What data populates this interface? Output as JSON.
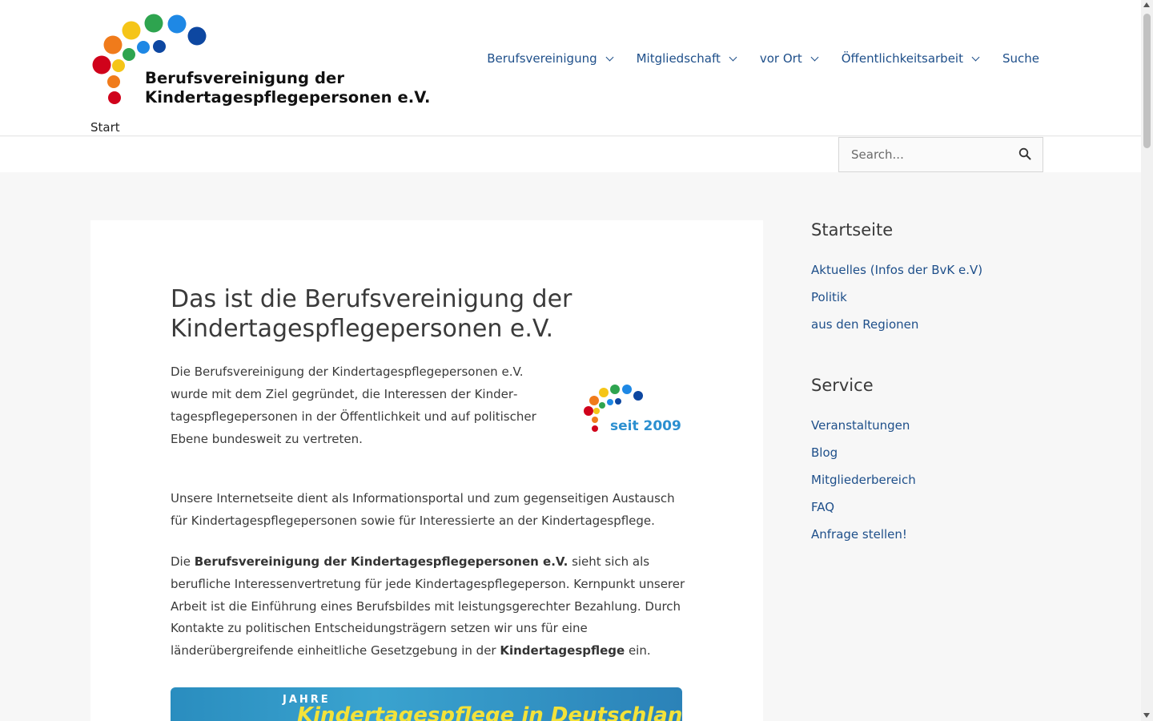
{
  "logo": {
    "line1": "Berufsvereinigung der",
    "line2": "Kindertagespflegepersonen e.V."
  },
  "nav": {
    "items": [
      {
        "label": "Berufsvereinigung",
        "has_dropdown": true
      },
      {
        "label": "Mitgliedschaft",
        "has_dropdown": true
      },
      {
        "label": "vor Ort",
        "has_dropdown": true
      },
      {
        "label": "Öffentlichkeitsarbeit",
        "has_dropdown": true
      },
      {
        "label": "Suche",
        "has_dropdown": false
      }
    ]
  },
  "breadcrumb": "Start",
  "search": {
    "placeholder": "Search...",
    "icon": "search-icon"
  },
  "main": {
    "title": "Das ist die Berufsvereinigung der Kindertagespflegepersonen e.V.",
    "intro": "Die Berufsvereinigung der Kindertagespflegepersonen e.V. wurde mit dem Ziel gegründet, die Interessen der Kinder­tagespflegepersonen in der Öffentlichkeit und auf politischer Ebene bundesweit zu vertreten.",
    "badge_text": "seit 2009",
    "p2": "Unsere Internetseite dient als Informationsportal und zum gegenseitigen Austausch für Kindertagespflegepersonen sowie für Interessierte an der Kindertagespflege.",
    "p3": {
      "t1": "Die ",
      "b1": "Berufsvereinigung der Kindertagespflegepersonen e.V.",
      "t2": " sieht sich als berufliche Interessenvertretung für jede Kindertagespflegeperson. Kernpunkt unserer Arbeit ist die Einführung eines Berufsbildes mit leistungsgerechter Bezahlung. Durch Kontakte zu politischen Entscheidungsträgern setzen wir uns für eine länderübergreifende einheitliche Gesetzgebung in der ",
      "b2": "Kindertagespflege",
      "t3": " ein."
    },
    "banner": {
      "jahre": "JAHRE",
      "title": "Kindertagespflege in Deutschland"
    }
  },
  "sidebar": {
    "widget1": {
      "title": "Startseite",
      "items": [
        "Aktuelles (Infos der BvK e.V)",
        "Politik",
        "aus den Regionen"
      ]
    },
    "widget2": {
      "title": "Service",
      "items": [
        "Veranstaltungen",
        "Blog",
        "Mitgliederbereich",
        "FAQ",
        "Anfrage stellen!"
      ]
    }
  },
  "colors": {
    "link": "#1e4f8a",
    "text": "#3a3a3a",
    "background": "#f7f7f7",
    "logo_dots": [
      "#d0021b",
      "#f07b1b",
      "#f5c518",
      "#2ea44f",
      "#1e88e5",
      "#0d47a1"
    ]
  }
}
